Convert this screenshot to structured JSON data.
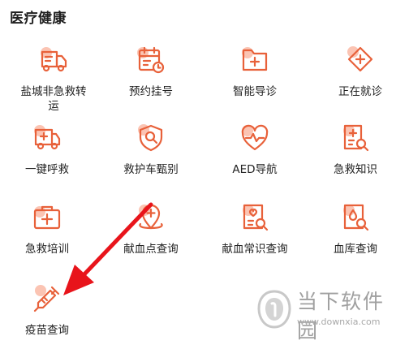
{
  "section": {
    "title": "医疗健康"
  },
  "services": [
    {
      "label": "盐城非急救转运",
      "icon": "ambulance-transfer-icon"
    },
    {
      "label": "预约挂号",
      "icon": "calendar-clock-icon"
    },
    {
      "label": "智能导诊",
      "icon": "first-aid-folder-icon"
    },
    {
      "label": "正在就诊",
      "icon": "diamond-plus-icon"
    },
    {
      "label": "一键呼救",
      "icon": "ambulance-icon"
    },
    {
      "label": "救护车甄别",
      "icon": "shield-search-icon"
    },
    {
      "label": "AED导航",
      "icon": "heart-pulse-icon"
    },
    {
      "label": "急救知识",
      "icon": "document-search-icon"
    },
    {
      "label": "急救培训",
      "icon": "first-aid-kit-icon"
    },
    {
      "label": "献血点查询",
      "icon": "location-plus-icon"
    },
    {
      "label": "献血常识查询",
      "icon": "heart-document-search-icon"
    },
    {
      "label": "血库查询",
      "icon": "blood-drop-search-icon"
    },
    {
      "label": "疫苗查询",
      "icon": "syringe-icon"
    }
  ],
  "colors": {
    "icon_stroke": "#e8613a",
    "icon_blob": "#fbc4b3",
    "arrow": "#e8141b",
    "watermark": "#a0a0a0"
  },
  "watermark": {
    "name": "当下软件园",
    "url": "www.downxia.com"
  }
}
